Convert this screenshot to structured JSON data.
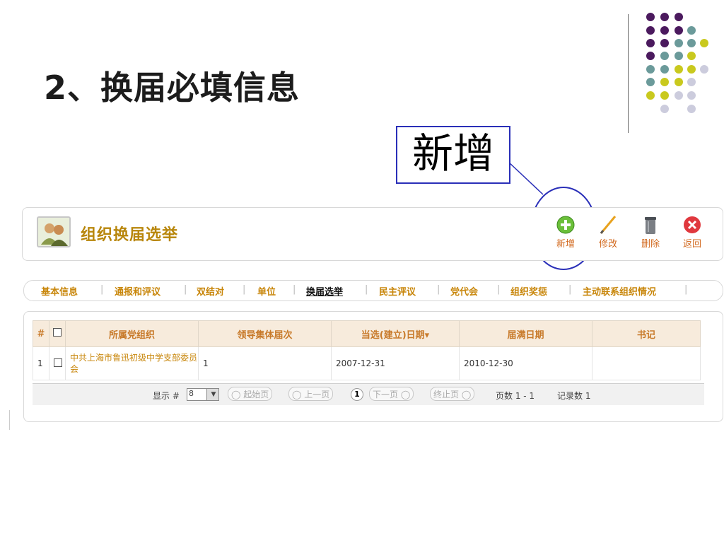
{
  "slide": {
    "title": "2、换届必填信息",
    "callout": "新增"
  },
  "header": {
    "title": "组织换届选举",
    "tools": [
      {
        "icon": "plus-circle-icon",
        "label": "新增"
      },
      {
        "icon": "pencil-icon",
        "label": "修改"
      },
      {
        "icon": "trash-icon",
        "label": "删除"
      },
      {
        "icon": "close-circle-icon",
        "label": "返回"
      }
    ]
  },
  "tabs": [
    {
      "label": "基本信息",
      "active": false
    },
    {
      "label": "通报和评议",
      "active": false
    },
    {
      "label": "双结对",
      "active": false
    },
    {
      "label": "单位",
      "active": false
    },
    {
      "label": "换届选举",
      "active": true
    },
    {
      "label": "民主评议",
      "active": false
    },
    {
      "label": "党代会",
      "active": false
    },
    {
      "label": "组织奖惩",
      "active": false
    },
    {
      "label": "主动联系组织情况",
      "active": false
    }
  ],
  "table": {
    "columns": [
      "#",
      "",
      "所属党组织",
      "领导集体届次",
      "当选(建立)日期▾",
      "届满日期",
      "书记"
    ],
    "rows": [
      {
        "index": "1",
        "org": "中共上海市鲁迅初级中学支部委员会",
        "term": "1",
        "elected": "2007-12-31",
        "expires": "2010-12-30",
        "secretary": ""
      }
    ]
  },
  "pager": {
    "show_label": "显示 #",
    "page_size": "8",
    "first": "起始页",
    "prev": "上一页",
    "current": "1",
    "next": "下一页",
    "last": "终止页",
    "pages_text": "页数 1 - 1",
    "records_text": "记录数 1"
  },
  "colors": {
    "accent": "#c8860a",
    "callout_border": "#2a2fb8",
    "dot_purple": "#4b1a5e",
    "dot_teal": "#6b9a9a",
    "dot_lime": "#c9c91e",
    "dot_lavender": "#ccccdd"
  }
}
